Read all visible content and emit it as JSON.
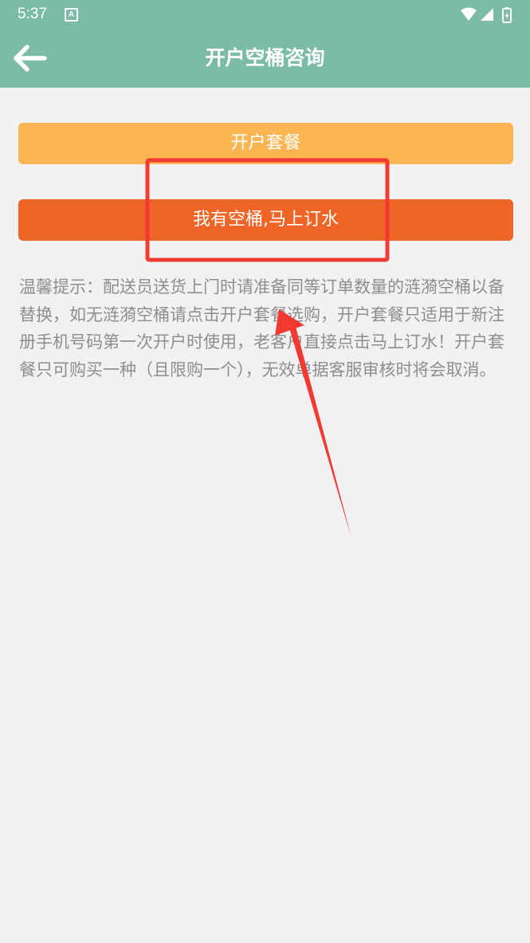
{
  "status_bar": {
    "time": "5:37",
    "notification_badge": "A"
  },
  "header": {
    "title": "开户空桶咨询"
  },
  "buttons": {
    "package_label": "开户套餐",
    "order_now_label": "我有空桶,马上订水"
  },
  "notice": {
    "text": "温馨提示：配送员送货上门时请准备同等订单数量的涟漪空桶以备替换，如无涟漪空桶请点击开户套餐选购，开户套餐只适用于新注册手机号码第一次开户时使用，老客户直接点击马上订水！开户套餐只可购买一种（且限购一个），无效单据客服审核时将会取消。"
  },
  "colors": {
    "appbar": "#7bbba8",
    "package_button": "#fbb653",
    "order_button": "#ef6528",
    "annotation": "#f23a33"
  },
  "icons": {
    "back": "arrow-left-icon",
    "wifi": "wifi-icon",
    "signal": "signal-icon",
    "battery": "battery-charging-icon"
  }
}
